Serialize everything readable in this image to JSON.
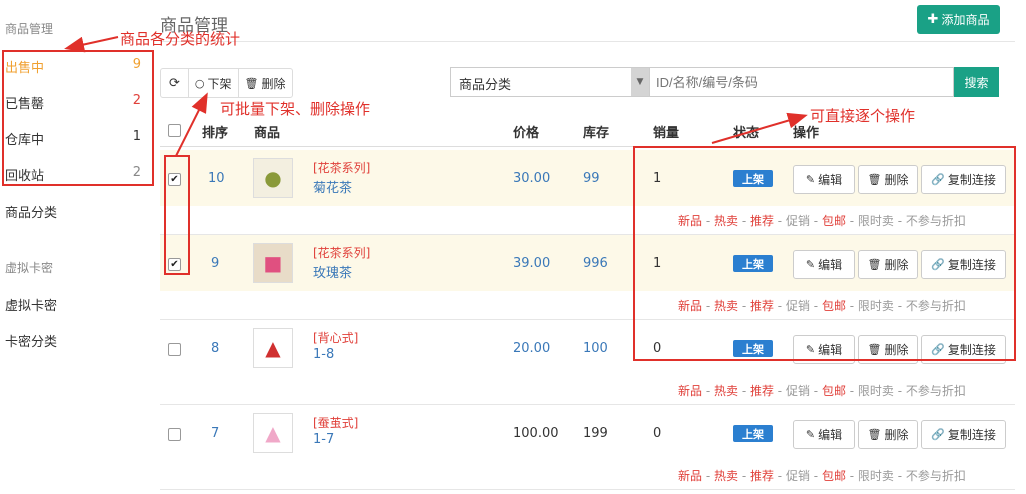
{
  "sidebar": {
    "section1": "商品管理",
    "items": [
      {
        "label": "出售中",
        "count": "9"
      },
      {
        "label": "已售罄",
        "count": "2"
      },
      {
        "label": "仓库中",
        "count": "1"
      },
      {
        "label": "回收站",
        "count": "2"
      }
    ],
    "category": "商品分类",
    "section2": "虚拟卡密",
    "card_items": [
      "虚拟卡密",
      "卡密分类"
    ]
  },
  "header": {
    "title": "商品管理",
    "add_button": "添加商品"
  },
  "toolbar": {
    "offshelf": "下架",
    "delete": "删除"
  },
  "search": {
    "category_value": "商品分类",
    "placeholder": "ID/名称/编号/条码",
    "button": "搜索"
  },
  "table": {
    "headers": [
      "排序",
      "商品",
      "价格",
      "库存",
      "销量",
      "状态",
      "操作"
    ],
    "rows": [
      {
        "order": "10",
        "category": "[花茶系列]",
        "name": "菊花茶",
        "price": "30.00",
        "stock": "99",
        "sales": "1",
        "status": "上架",
        "checked": true
      },
      {
        "order": "9",
        "category": "[花茶系列]",
        "name": "玫瑰茶",
        "price": "39.00",
        "stock": "996",
        "sales": "1",
        "status": "上架",
        "checked": true
      },
      {
        "order": "8",
        "category": "[背心式]",
        "name": "1-8",
        "price": "20.00",
        "stock": "100",
        "sales": "0",
        "status": "上架",
        "checked": false
      },
      {
        "order": "7",
        "category": "[蚕茧式]",
        "name": "1-7",
        "price": "100.00",
        "stock": "199",
        "sales": "0",
        "status": "上架",
        "checked": false
      }
    ],
    "ops": {
      "edit": "编辑",
      "delete": "删除",
      "copy": "复制连接"
    },
    "tags": [
      "新品",
      "热卖",
      "推荐",
      "促销",
      "包邮",
      "限时卖",
      "不参与折扣"
    ],
    "tag_sep": " - "
  },
  "annotations": {
    "stats": "商品各分类的统计",
    "batch": "可批量下架、删除操作",
    "direct": "可直接逐个操作"
  },
  "colors": {
    "accent_green": "#1aa186",
    "status_blue": "#2b7fd0",
    "annotation_red": "#e0302a",
    "highlight_row": "#fdf9e8"
  }
}
